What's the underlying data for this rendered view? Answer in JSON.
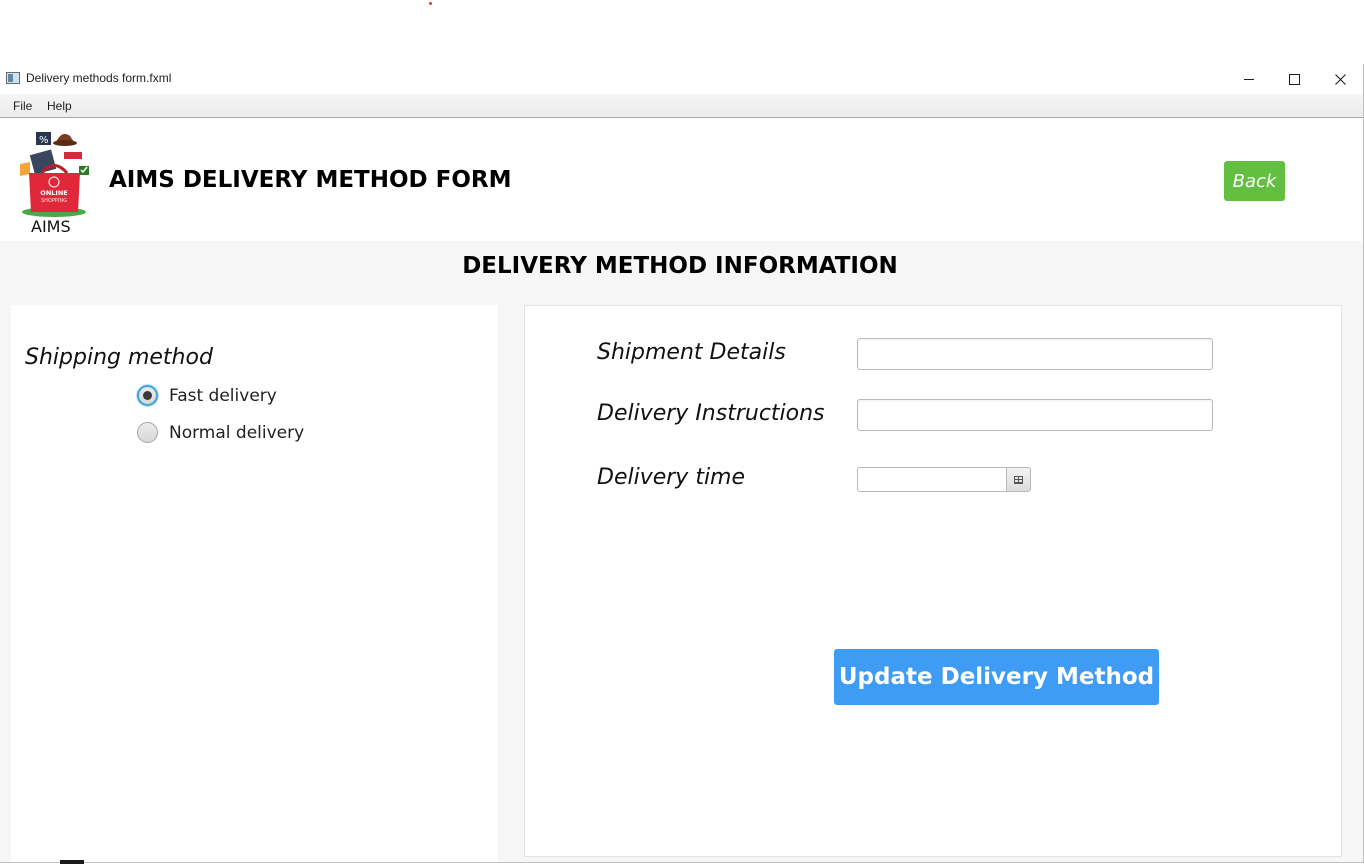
{
  "window": {
    "title": "Delivery methods form.fxml"
  },
  "menu": {
    "file": "File",
    "help": "Help"
  },
  "header": {
    "logo_caption": "AIMS",
    "logo_text_line1": "ONLINE",
    "logo_text_line2": "SHOPPING",
    "form_title": "AIMS DELIVERY METHOD FORM",
    "back_label": "Back"
  },
  "section_title": "DELIVERY METHOD INFORMATION",
  "shipping": {
    "label": "Shipping method",
    "options": [
      {
        "label": "Fast delivery",
        "selected": true
      },
      {
        "label": "Normal delivery",
        "selected": false
      }
    ]
  },
  "form": {
    "shipment_details_label": "Shipment Details",
    "shipment_details_value": "",
    "delivery_instructions_label": "Delivery Instructions",
    "delivery_instructions_value": "",
    "delivery_time_label": "Delivery time",
    "delivery_time_value": "",
    "update_label": "Update Delivery Method"
  },
  "colors": {
    "back_button": "#62bf3f",
    "update_button": "#3f9cf5",
    "radio_focus": "#3ea3d8",
    "content_background": "#f6f6f6"
  },
  "icons": {
    "app": "window-app-icon",
    "minimize": "minimize-icon",
    "maximize": "maximize-icon",
    "close": "close-icon",
    "calendar": "calendar-icon"
  }
}
